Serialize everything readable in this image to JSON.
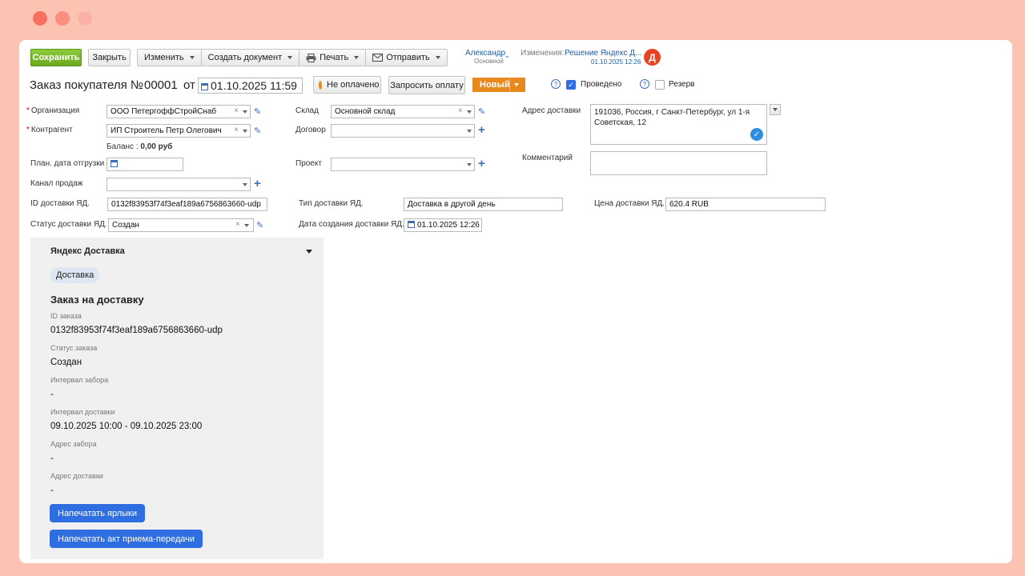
{
  "toolbar": {
    "save": "Сохранить",
    "close": "Закрыть",
    "change": "Изменить",
    "create_doc": "Создать документ",
    "print": "Печать",
    "send": "Отправить"
  },
  "user": {
    "name": "Александр",
    "role": "Основной"
  },
  "changes": {
    "label": "Изменения:",
    "link": "Решение Яндекс Д...",
    "date": "01.10.2025 12:26"
  },
  "header": {
    "title": "Заказ покупателя №",
    "number": "00001",
    "from": "от",
    "datetime": "01.10.2025 11:59",
    "payment_status": "Не оплачено",
    "request_payment": "Запросить оплату",
    "status": "Новый",
    "posted_label": "Проведено",
    "posted": true,
    "reserve_label": "Резерв",
    "reserve": false,
    "help": "?"
  },
  "form": {
    "org_label": "Организация",
    "org_value": "ООО ПетергоффСтройСнаб",
    "contractor_label": "Контрагент",
    "contractor_value": "ИП Строитель Петр Олегович",
    "balance_label": "Баланс :",
    "balance_value": "0,00 руб",
    "ship_date_label": "План. дата отгрузки",
    "channel_label": "Канал продаж",
    "warehouse_label": "Склад",
    "warehouse_value": "Основной склад",
    "contract_label": "Договор",
    "project_label": "Проект",
    "address_label": "Адрес доставки",
    "address_value": "191036, Россия, г Санкт-Петербург, ул 1-я Советская, 12",
    "comment_label": "Комментарий",
    "yd_id_label": "ID доставки ЯД.",
    "yd_id_value": "0132f83953f74f3eaf189a6756863660-udp",
    "yd_type_label": "Тип доставки ЯД.",
    "yd_type_value": "Доставка в другой день",
    "yd_price_label": "Цена доставки ЯД.",
    "yd_price_value": "620.4 RUB",
    "yd_status_label": "Статус доставки ЯД.",
    "yd_status_value": "Создан",
    "yd_created_label": "Дата создания доставки ЯД.",
    "yd_created_value": "01.10.2025 12:26"
  },
  "panel": {
    "title": "Яндекс Доставка",
    "chip": "Доставка",
    "heading": "Заказ на доставку",
    "order_id_label": "ID заказа",
    "order_id": "0132f83953f74f3eaf189a6756863660-udp",
    "status_label": "Статус заказа",
    "status": "Создан",
    "pickup_interval_label": "Интервал забора",
    "pickup_interval": "-",
    "delivery_interval_label": "Интервал доставки",
    "delivery_interval": "09.10.2025 10:00 - 09.10.2025 23:00",
    "pickup_address_label": "Адрес забора",
    "pickup_address": "-",
    "delivery_address_label": "Адрес доставки",
    "delivery_address": "-",
    "print_labels": "Напечатать ярлыки",
    "print_act": "Напечатать акт приема-передачи"
  }
}
